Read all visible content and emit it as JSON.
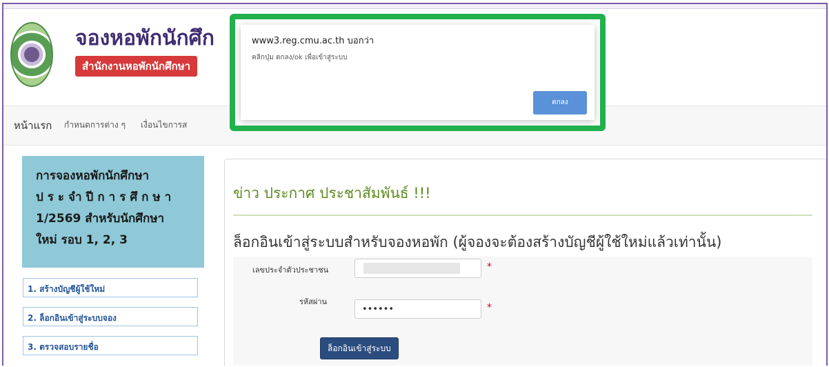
{
  "header": {
    "title": "จองหอพักนักศึก",
    "subtitle": "สำนักงานหอพักนักศึกษา"
  },
  "nav": {
    "items": [
      "หน้าแรก",
      "กำหนดการต่าง ๆ",
      "เงื่อนไขการส"
    ]
  },
  "sidebar": {
    "notice_lines": [
      "การจองหอพักนักศึกษา",
      "ประจำปีการศึกษา",
      "1/2569 สำหรับนักศึกษา",
      "ใหม่ รอบ 1, 2, 3"
    ],
    "links": [
      "1. สร้างบัญชีผู้ใช้ใหม่",
      "2. ล็อกอินเข้าสู่ระบบจอง",
      "3. ตรวจสอบรายชื่อ"
    ]
  },
  "main": {
    "news_title": "ข่าว ประกาศ ประชาสัมพันธ์ !!!",
    "login_heading": "ล็อกอินเข้าสู่ระบบสำหรับจองหอพัก (ผู้จองจะต้องสร้างบัญชีผู้ใช้ใหม่แล้วเท่านั้น)",
    "form": {
      "id_label": "เลขประจำตัวประชาชน",
      "password_label": "รหัสผ่าน",
      "password_value": "••••••",
      "required_mark": "*",
      "login_button": "ล็อกอินเข้าสู่ระบบ"
    }
  },
  "dialog": {
    "origin": "www3.reg.cmu.ac.th บอกว่า",
    "message": "คลิกปุ่ม ตกลง/ok เพื่อเข้าสู่ระบบ",
    "ok_label": "ตกลง"
  },
  "colors": {
    "highlight": "#22b14c",
    "title": "#3f2d73",
    "subtitle_bg": "#d63a3a",
    "sidebar_bg": "#8fc9d8",
    "news": "#5e8a1e",
    "button": "#2b4c7e"
  },
  "icons": [
    "university-logo"
  ]
}
